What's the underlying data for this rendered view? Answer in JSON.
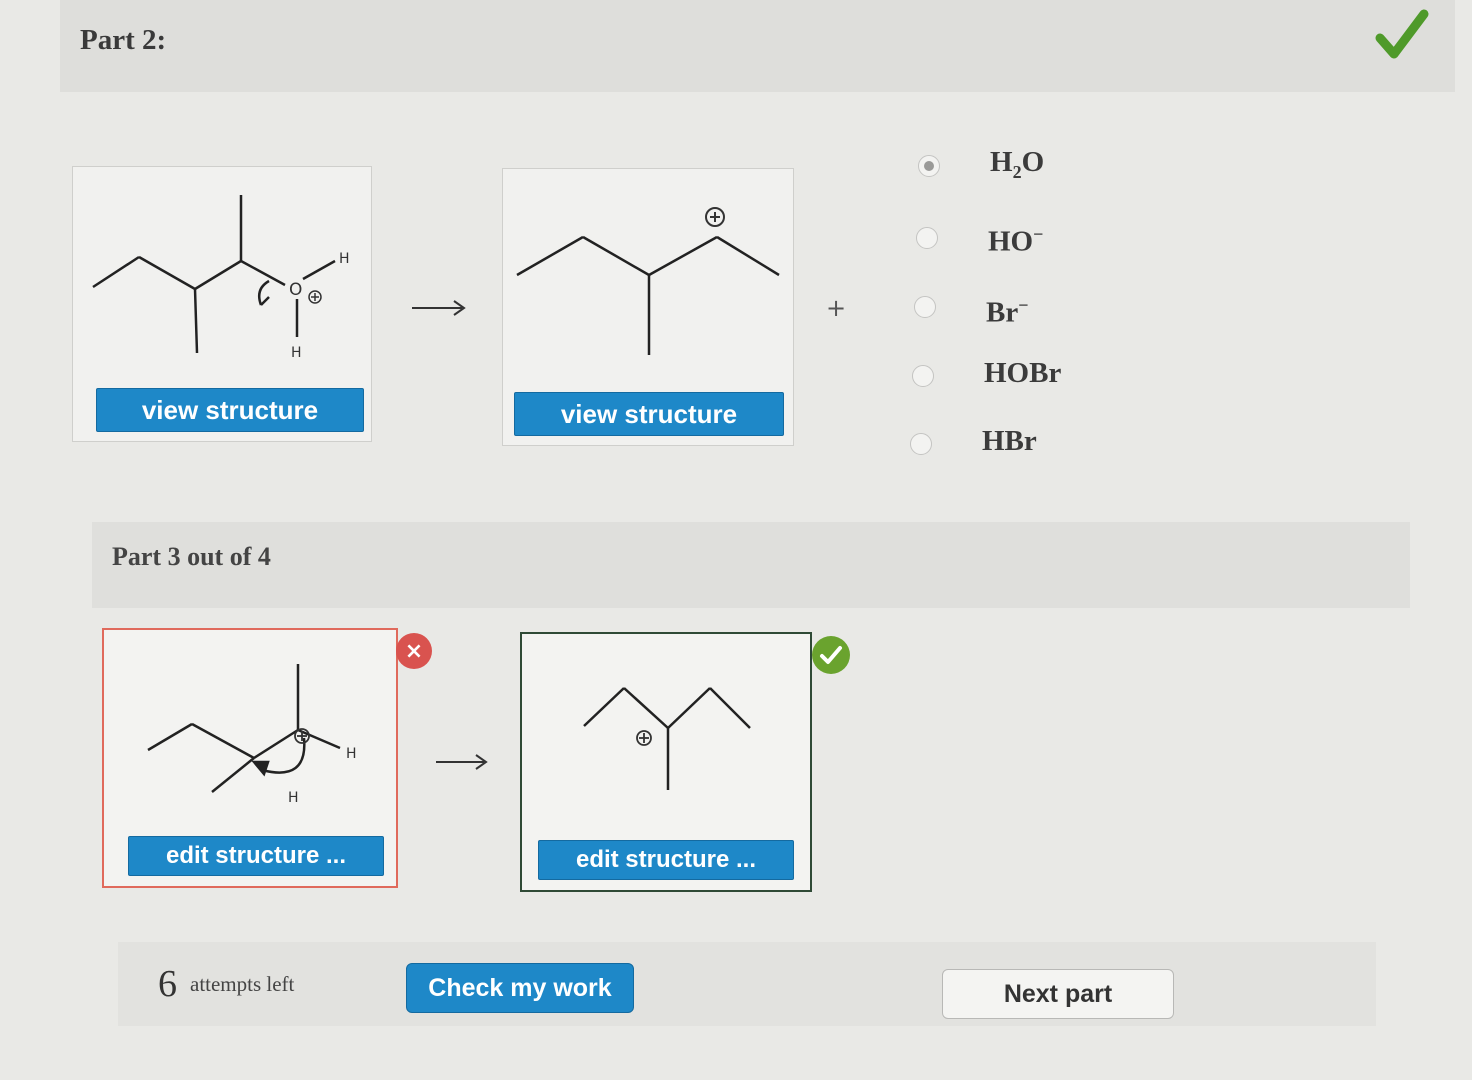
{
  "part2": {
    "title": "Part 2:",
    "reactant_button": "view structure",
    "product_button": "view structure",
    "plus": "+",
    "choices": [
      {
        "label": "H",
        "sub": "2",
        "rest": "O",
        "selected": true
      },
      {
        "label": "HO",
        "sup": "−",
        "selected": false
      },
      {
        "label": "Br",
        "sup": "−",
        "selected": false
      },
      {
        "label": "HOBr",
        "selected": false
      },
      {
        "label": "HBr",
        "selected": false
      }
    ],
    "atom_labels": {
      "H": "H",
      "O": "O"
    }
  },
  "part3": {
    "title": "Part 3 out of 4",
    "left_button": "edit structure ...",
    "right_button": "edit structure ...",
    "wrong_badge": "×"
  },
  "footer": {
    "attempts_number": "6",
    "attempts_text": "attempts left",
    "check_button": "Check my work",
    "next_button": "Next part"
  },
  "colors": {
    "accent": "#1e88c8",
    "correct": "#6aa32e",
    "incorrect": "#d9534f"
  }
}
